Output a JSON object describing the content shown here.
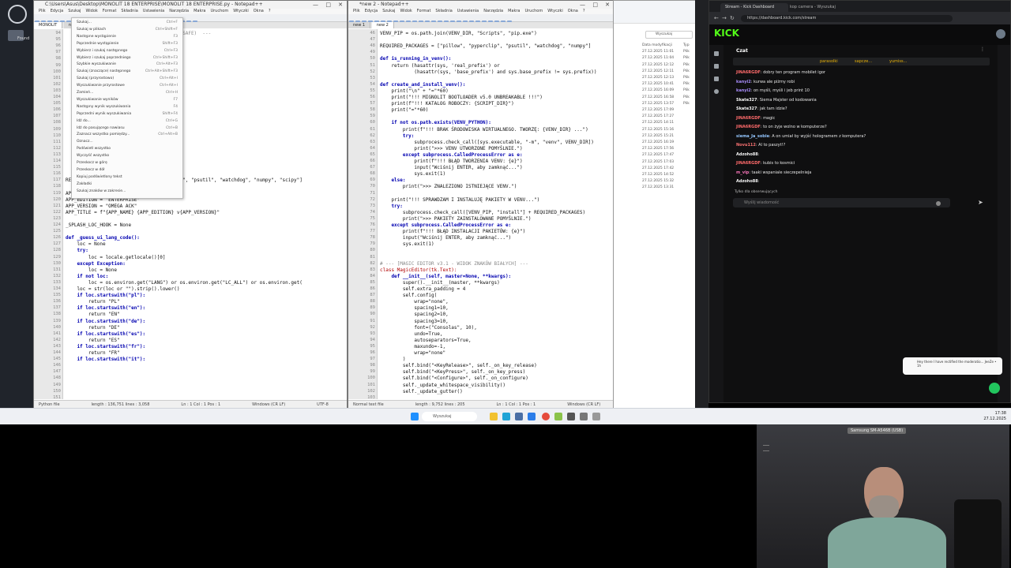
{
  "screen": {
    "desktop_icon_label": "Found"
  },
  "left_editor": {
    "title": "C:\\Users\\Asus\\Desktop\\MONOLIT 18 ENTERPRISE\\MONOLIT 18 ENTERPRISE.py - Notepad++",
    "menu": [
      "Plik",
      "Edycja",
      "Szukaj",
      "Widok",
      "Format",
      "Składnia",
      "Ustawienia",
      "Narzędzia",
      "Makra",
      "Uruchom",
      "Wtyczki",
      "Okna",
      "?"
    ],
    "tabs": [
      "MONOLIT",
      "new 1"
    ],
    "line_numbers": [
      "94",
      "95",
      "96",
      "97",
      "98",
      "99",
      "100",
      "101",
      "102",
      "103",
      "104",
      "105",
      "106",
      "107",
      "108",
      "109",
      "110",
      "111",
      "112",
      "113",
      "114",
      "115",
      "116",
      "117",
      "118",
      "119",
      "120",
      "121",
      "122",
      "123",
      "124",
      "125",
      "126",
      "127",
      "128",
      "129",
      "130",
      "131",
      "132",
      "133",
      "134",
      "135",
      "136",
      "137",
      "138",
      "139",
      "140",
      "141",
      "142",
      "143",
      "144",
      "145",
      "146",
      "147",
      "148",
      "149",
      "150",
      "151",
      "152",
      "153"
    ],
    "code_lines": [
      {
        "t": "                          MENTALNOŚĆ FAILSAFE)  ---",
        "c": "st"
      },
      {
        "t": "",
        "c": ""
      },
      {
        "t": "          ):",
        "c": ""
      },
      {
        "t": "",
        "c": ""
      },
      {
        "t": "          os.path.abspath(sys.executable)",
        "c": ""
      },
      {
        "t": "",
        "c": ""
      },
      {
        "t": "",
        "c": ""
      },
      {
        "t": "          abspath(__file__))",
        "c": ""
      },
      {
        "t": "",
        "c": ""
      },
      {
        "t": "          )",
        "c": ""
      },
      {
        "t": "",
        "c": ""
      },
      {
        "t": "",
        "c": ""
      },
      {
        "t": "",
        "c": ""
      },
      {
        "t": "",
        "c": ""
      },
      {
        "t": "",
        "c": ""
      },
      {
        "t": "          \"venv\")",
        "c": ""
      },
      {
        "t": "",
        "c": ""
      },
      {
        "t": "          DIR, \"Scripts\", \"python.exe\")",
        "c": ""
      },
      {
        "t": "          R, \"Scripts\", \"pip.exe\")",
        "c": ""
      },
      {
        "t": "",
        "c": ""
      },
      {
        "t": "          DIR, \"bin\", \"python\")",
        "c": ""
      },
      {
        "t": "          R, \"bin\", \"pip\")",
        "c": ""
      },
      {
        "t": "",
        "c": ""
      },
      {
        "t": "REQUIRED_PACKAGES = [\"pillow\", \"pyperclip\", \"psutil\", \"watchdog\", \"numpy\", \"scipy\"]",
        "c": ""
      },
      {
        "t": "",
        "c": ""
      },
      {
        "t": "APP_NAME = \"MONOLIT 18\"",
        "c": ""
      },
      {
        "t": "APP_EDITION = \"ENTERPRISE\"",
        "c": ""
      },
      {
        "t": "APP_VERSION = \"OMEGA ACK\"",
        "c": ""
      },
      {
        "t": "APP_TITLE = f\"{APP_NAME} {APP_EDITION} v{APP_VERSION}\"",
        "c": ""
      },
      {
        "t": "",
        "c": ""
      },
      {
        "t": "_SPLASH_LOC_HOOK = None",
        "c": ""
      },
      {
        "t": "",
        "c": ""
      },
      {
        "t": "def _guess_ui_lang_code():",
        "c": "kw"
      },
      {
        "t": "    loc = None",
        "c": ""
      },
      {
        "t": "    try:",
        "c": "kw"
      },
      {
        "t": "        loc = locale.getlocale()[0]",
        "c": ""
      },
      {
        "t": "    except Exception:",
        "c": "kw"
      },
      {
        "t": "        loc = None",
        "c": ""
      },
      {
        "t": "    if not loc:",
        "c": "kw"
      },
      {
        "t": "        loc = os.environ.get(\"LANG\") or os.environ.get(\"LC_ALL\") or os.environ.get(",
        "c": ""
      },
      {
        "t": "    loc = str(loc or \"\").strip().lower()",
        "c": ""
      },
      {
        "t": "    if loc.startswith(\"pl\"):",
        "c": "kw"
      },
      {
        "t": "        return \"PL\"",
        "c": ""
      },
      {
        "t": "    if loc.startswith(\"en\"):",
        "c": "kw"
      },
      {
        "t": "        return \"EN\"",
        "c": ""
      },
      {
        "t": "    if loc.startswith(\"de\"):",
        "c": "kw"
      },
      {
        "t": "        return \"DE\"",
        "c": ""
      },
      {
        "t": "    if loc.startswith(\"es\"):",
        "c": "kw"
      },
      {
        "t": "        return \"ES\"",
        "c": ""
      },
      {
        "t": "    if loc.startswith(\"fr\"):",
        "c": "kw"
      },
      {
        "t": "        return \"FR\"",
        "c": ""
      },
      {
        "t": "    if loc.startswith(\"it\"):",
        "c": "kw"
      }
    ],
    "status": [
      "Python file",
      "length : 136,751   lines : 3,058",
      "Ln : 1   Col : 1   Pos : 1",
      "Windows (CR LF)",
      "UTF-8",
      "INS"
    ]
  },
  "left_menu": {
    "items": [
      {
        "label": "Szukaj...",
        "shortcut": "Ctrl+F"
      },
      {
        "label": "Szukaj w plikach",
        "shortcut": "Ctrl+Shift+F"
      },
      {
        "label": "Następne wystąpienie",
        "shortcut": "F3"
      },
      {
        "label": "Poprzednie wystąpienie",
        "shortcut": "Shift+F3"
      },
      {
        "label": "Wybierz i szukaj następnego",
        "shortcut": "Ctrl+F3"
      },
      {
        "label": "Wybierz i szukaj poprzedniego",
        "shortcut": "Ctrl+Shift+F3"
      },
      {
        "label": "Szybkie wyszukiwanie",
        "shortcut": "Ctrl+Alt+F3"
      },
      {
        "label": "Szukaj (znaczące) następnego",
        "shortcut": "Ctrl+Alt+Shift+F3"
      },
      {
        "label": "Szukaj (przyrostowo)",
        "shortcut": "Ctrl+Alt+I"
      },
      {
        "label": "Wyszukiwanie przyrostowe",
        "shortcut": "Ctrl+Alt+I"
      },
      {
        "label": "Zamień...",
        "shortcut": "Ctrl+H"
      },
      {
        "label": "Wyszukiwanie wyników",
        "shortcut": "F7"
      },
      {
        "label": "Następny wynik wyszukiwania",
        "shortcut": "F4"
      },
      {
        "label": "Poprzedni wynik wyszukiwania",
        "shortcut": "Shift+F4"
      },
      {
        "label": "Idź do...",
        "shortcut": "Ctrl+G"
      },
      {
        "label": "Idź do pasującego nawiasu",
        "shortcut": "Ctrl+B"
      },
      {
        "label": "Zaznacz wszystko pomiędzy...",
        "shortcut": "Ctrl+Alt+B"
      },
      {
        "label": "Oznacz...",
        "shortcut": ""
      },
      {
        "label": "Podświetl wszystko",
        "shortcut": ""
      },
      {
        "label": "Wyczyść wszystko",
        "shortcut": ""
      },
      {
        "label": "Przeskocz w górę",
        "shortcut": ""
      },
      {
        "label": "Przeskocz w dół",
        "shortcut": ""
      },
      {
        "label": "Kopiuj podświetlony tekst",
        "shortcut": ""
      },
      {
        "label": "Zakładki",
        "shortcut": ""
      },
      {
        "label": "Szukaj znaków w zakresie...",
        "shortcut": ""
      }
    ]
  },
  "right_editor": {
    "title": "*new 2 - Notepad++",
    "menu": [
      "Plik",
      "Edycja",
      "Szukaj",
      "Widok",
      "Format",
      "Składnia",
      "Ustawienia",
      "Narzędzia",
      "Makra",
      "Uruchom",
      "Wtyczki",
      "Okna",
      "?"
    ],
    "tabs": [
      "new 1",
      "new 2"
    ],
    "line_numbers": [
      "46",
      "47",
      "48",
      "49",
      "50",
      "51",
      "52",
      "53",
      "54",
      "55",
      "56",
      "57",
      "58",
      "59",
      "60",
      "61",
      "62",
      "63",
      "64",
      "65",
      "66",
      "67",
      "68",
      "69",
      "70",
      "71",
      "72",
      "73",
      "74",
      "75",
      "76",
      "77",
      "78",
      "79",
      "80",
      "81",
      "82",
      "83",
      "84",
      "85",
      "86",
      "87",
      "88",
      "89",
      "90",
      "91",
      "92",
      "93",
      "94",
      "95",
      "96",
      "97",
      "98",
      "99",
      "100",
      "101",
      "102",
      "103",
      "104",
      "105"
    ],
    "code_lines": [
      {
        "t": "VENV_PIP = os.path.join(VENV_DIR, \"Scripts\", \"pip.exe\")",
        "c": ""
      },
      {
        "t": "",
        "c": ""
      },
      {
        "t": "REQUIRED_PACKAGES = [\"pillow\", \"pyperclip\", \"psutil\", \"watchdog\", \"numpy\"]",
        "c": ""
      },
      {
        "t": "",
        "c": ""
      },
      {
        "t": "def is_running_in_venv():",
        "c": "kw"
      },
      {
        "t": "    return (hasattr(sys, 'real_prefix') or",
        "c": ""
      },
      {
        "t": "            (hasattr(sys, 'base_prefix') and sys.base_prefix != sys.prefix))",
        "c": ""
      },
      {
        "t": "",
        "c": ""
      },
      {
        "t": "def create_and_install_venv():",
        "c": "kw"
      },
      {
        "t": "    print(\"\\n\" + \"=\"*60)",
        "c": ""
      },
      {
        "t": "    print(\"!!! MIGNOLIT BOOTLOADER v5.0 UNBREAKABLE !!!\")",
        "c": ""
      },
      {
        "t": "    print(f\"!!! KATALOG ROBOCZY: {SCRIPT_DIR}\")",
        "c": ""
      },
      {
        "t": "    print(\"=\"*60)",
        "c": ""
      },
      {
        "t": "",
        "c": ""
      },
      {
        "t": "    if not os.path.exists(VENV_PYTHON):",
        "c": "kw"
      },
      {
        "t": "        print(f\"!!! BRAK ŚRODOWISKA WIRTUALNEGO. TWORZĘ: {VENV_DIR} ...\")",
        "c": ""
      },
      {
        "t": "        try:",
        "c": "kw"
      },
      {
        "t": "            subprocess.check_call([sys.executable, \"-m\", \"venv\", VENV_DIR])",
        "c": ""
      },
      {
        "t": "            print(\">>> VENV UTWORZONE POMYŚLNIE.\")",
        "c": ""
      },
      {
        "t": "        except subprocess.CalledProcessError as e:",
        "c": "kw"
      },
      {
        "t": "            print(f\"!!! BŁĄD TWORZENIA VENV: {e}\")",
        "c": ""
      },
      {
        "t": "            input(\"Wciśnij ENTER, aby zamknąć...\")",
        "c": ""
      },
      {
        "t": "            sys.exit(1)",
        "c": ""
      },
      {
        "t": "    else:",
        "c": "kw"
      },
      {
        "t": "        print(\">>> ZNALEZIONO ISTNIEJĄCE VENV.\")",
        "c": ""
      },
      {
        "t": "",
        "c": ""
      },
      {
        "t": "    print(\"!!! SPRAWDZAM I INSTALUJĘ PAKIETY W VENV...\")",
        "c": ""
      },
      {
        "t": "    try:",
        "c": "kw"
      },
      {
        "t": "        subprocess.check_call([VENV_PIP, \"install\"] + REQUIRED_PACKAGES)",
        "c": ""
      },
      {
        "t": "        print(\">>> PAKIETY ZAINSTALOWANE POMYŚLNIE.\")",
        "c": ""
      },
      {
        "t": "    except subprocess.CalledProcessError as e:",
        "c": "kw"
      },
      {
        "t": "        print(f\"!!! BŁĄD INSTALACJI PAKIETÓW: {e}\")",
        "c": ""
      },
      {
        "t": "        input(\"Wciśnij ENTER, aby zamknąć...\")",
        "c": ""
      },
      {
        "t": "        sys.exit(1)",
        "c": ""
      },
      {
        "t": "",
        "c": ""
      },
      {
        "t": "",
        "c": ""
      },
      {
        "t": "# --- [MAGIC EDITOR v3.1 - WIDOK ZNAKÓW BIAŁYCH] ---",
        "c": "st"
      },
      {
        "t": "class MagicEditor(tk.Text):",
        "c": "red"
      },
      {
        "t": "    def __init__(self, master=None, **kwargs):",
        "c": "kw"
      },
      {
        "t": "        super().__init__(master, **kwargs)",
        "c": ""
      },
      {
        "t": "        self.extra_padding = 4",
        "c": ""
      },
      {
        "t": "        self.config(",
        "c": ""
      },
      {
        "t": "            wrap=\"none\",",
        "c": ""
      },
      {
        "t": "            spacing1=10,",
        "c": ""
      },
      {
        "t": "            spacing2=10,",
        "c": ""
      },
      {
        "t": "            spacing3=10,",
        "c": ""
      },
      {
        "t": "            font=(\"Consolas\", 10),",
        "c": ""
      },
      {
        "t": "            undo=True,",
        "c": ""
      },
      {
        "t": "            autoseparators=True,",
        "c": ""
      },
      {
        "t": "            maxundo=-1,",
        "c": ""
      },
      {
        "t": "            wrap=\"none\"",
        "c": ""
      },
      {
        "t": "        )",
        "c": ""
      },
      {
        "t": "        self.bind(\"<KeyRelease>\", self._on_key_release)",
        "c": ""
      },
      {
        "t": "        self.bind(\"<KeyPress>\", self._on_key_press)",
        "c": ""
      },
      {
        "t": "        self.bind(\"<Configure>\", self._on_configure)",
        "c": ""
      },
      {
        "t": "        self._update_whitespace_visibility()",
        "c": ""
      },
      {
        "t": "        self._update_gutter()",
        "c": ""
      }
    ],
    "status": [
      "Normal text file",
      "length : 9,752   lines : 205",
      "Ln : 1   Col : 1   Pos : 1",
      "Windows (CR LF)",
      "UTF-8",
      "INS"
    ]
  },
  "explorer": {
    "rows": [
      "Data modyfikacji",
      "27.12.2025 11:01",
      "27.12.2025 11:04",
      "27.12.2025 12:12",
      "27.12.2025 12:11",
      "27.12.2025 12:13",
      "27.12.2025 10:41",
      "27.12.2025 16:09",
      "27.12.2025 16:58",
      "27.12.2025 13:57",
      "27.12.2025 17:09",
      "27.12.2025 17:27",
      "27.12.2025 14:11",
      "27.12.2025 15:16",
      "27.12.2025 15:21",
      "27.12.2025 16:19",
      "27.12.2025 17:56",
      "27.12.2025 17:47",
      "27.12.2025 17:03",
      "27.12.2025 17:42",
      "27.12.2025 14:52",
      "27.12.2025 15:32",
      "27.12.2025 13:31"
    ],
    "types": [
      "Typ",
      "Plik",
      "Plik",
      "Plik",
      "Plik",
      "Plik",
      "Plik",
      "Plik",
      "Plik",
      "Plik"
    ],
    "search_label": "Wyszukaj"
  },
  "browser": {
    "tab1": "Stream - Kick Dashboard",
    "tab2": "kop camera - Wyszukaj",
    "url": "https://dashboard.kick.com/stream",
    "logo": "KICK",
    "chat_title": "Czat",
    "pinned": [
      "parasolki",
      "sapcze...",
      "yumiss..."
    ],
    "messages": [
      {
        "user": "JINA6RGDF",
        "text": "dobry ten program mobilet igor"
      },
      {
        "user": "kanyi2",
        "text": "kurwa ale piżmy robi"
      },
      {
        "user": "kanyi2",
        "text": "on myśli, myśli i jeb print 10"
      },
      {
        "user": "Skate327",
        "text": "Siema Majster od kodowania"
      },
      {
        "user": "Skate327",
        "text": "jak tam idzie?"
      },
      {
        "user": "JINA6RGDF",
        "text": "magic"
      },
      {
        "user": "JINA6RGDF",
        "text": "to on żyje wolno w komputerze?"
      },
      {
        "user": "siema_Ja_sobie",
        "text": "A on umiał by wyjść hologramem z komputera?"
      },
      {
        "user": "Novu112",
        "text": "Al to paszyt!?"
      },
      {
        "user": "Adzoho88",
        "text": ""
      },
      {
        "user": "JINA6RGDF",
        "text": "kubis to kosmici"
      },
      {
        "user": "m_vip",
        "text": "taaki wspaniale sieczepelnieja"
      },
      {
        "user": "Adzoho88",
        "text": ""
      }
    ],
    "followers_only": "Tylko dla obserwujących",
    "chat_placeholder": "Wyślij wiadomość",
    "toast": "Hey there I have rectified the moderatio... JeeZe • 1h"
  },
  "taskbar": {
    "search_label": "Wyszukaj",
    "time": "17:38",
    "date": "27.12.2025"
  },
  "webcam": {
    "label": "Samsung SM-A546B (USB)"
  }
}
